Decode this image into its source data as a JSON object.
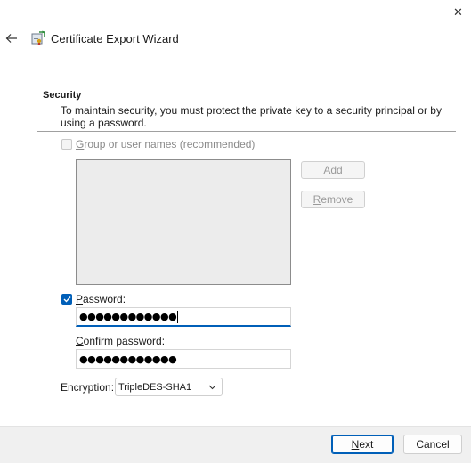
{
  "window": {
    "title": "Certificate Export Wizard",
    "close_glyph": "✕",
    "back_glyph": "←"
  },
  "security": {
    "heading": "Security",
    "description": "To maintain security, you must protect the private key to a security principal or by using a password.",
    "group_checkbox": {
      "label_accesskey": "G",
      "label_rest": "roup or user names (recommended)",
      "checked": false,
      "enabled": false
    },
    "add_button": {
      "accesskey": "A",
      "rest": "dd"
    },
    "remove_button": {
      "accesskey": "R",
      "rest": "emove"
    }
  },
  "password": {
    "checkbox_checked": true,
    "label_accesskey": "P",
    "label_rest": "assword:",
    "value_masked": "●●●●●●●●●●●●"
  },
  "confirm_password": {
    "label_accesskey": "C",
    "label_rest": "onfirm password:",
    "value_masked": "●●●●●●●●●●●●"
  },
  "encryption": {
    "label": "Encryption:",
    "selected": "TripleDES-SHA1"
  },
  "footer": {
    "next": {
      "accesskey": "N",
      "rest": "ext"
    },
    "cancel": "Cancel"
  },
  "colors": {
    "accent": "#005fb8",
    "footer_bg": "#f0f0f0",
    "list_bg": "#ececec"
  },
  "icons": {
    "close": "close-icon",
    "back": "back-arrow-icon",
    "wizard": "certificate-wizard-icon",
    "check": "check-icon",
    "dropdown": "chevron-down-icon"
  }
}
